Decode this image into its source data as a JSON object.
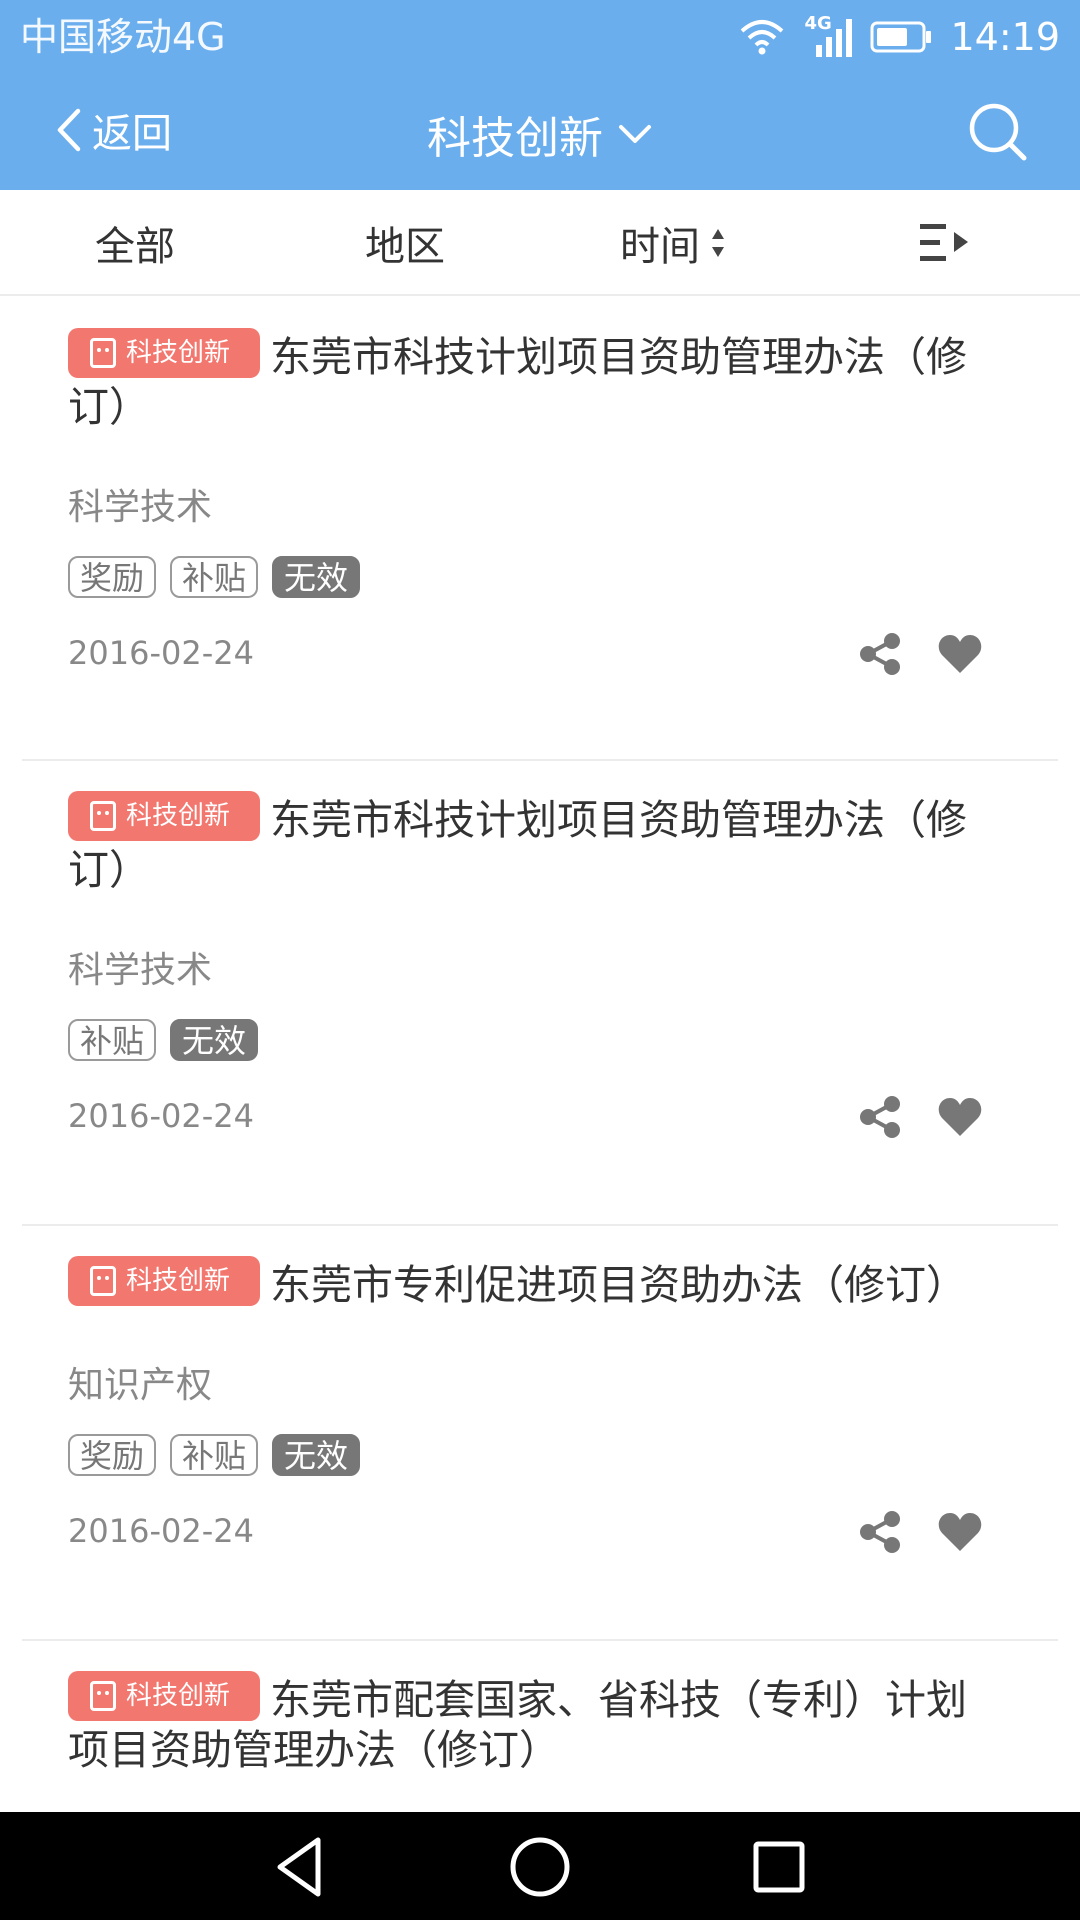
{
  "status_bar": {
    "carrier": "中国移动4G",
    "network": "4G",
    "time": "14:19"
  },
  "header": {
    "back_label": "返回",
    "title": "科技创新",
    "background_color": "#6aaeee"
  },
  "filters": [
    {
      "label": "全部"
    },
    {
      "label": "地区"
    },
    {
      "label": "时间"
    }
  ],
  "items": [
    {
      "badge": "科技创新",
      "title": "东莞市科技计划项目资助管理办法（修订）",
      "category": "科学技术",
      "tags": [
        "奖励",
        "补贴"
      ],
      "status": "无效",
      "date": "2016-02-24"
    },
    {
      "badge": "科技创新",
      "title": "东莞市科技计划项目资助管理办法（修订）",
      "category": "科学技术",
      "tags": [
        "补贴"
      ],
      "status": "无效",
      "date": "2016-02-24"
    },
    {
      "badge": "科技创新",
      "title": "东莞市专利促进项目资助办法（修订）",
      "category": "知识产权",
      "tags": [
        "奖励",
        "补贴"
      ],
      "status": "无效",
      "date": "2016-02-24"
    },
    {
      "badge": "科技创新",
      "title": "东莞市配套国家、省科技（专利）计划项目资助管理办法（修订）"
    }
  ],
  "colors": {
    "accent": "#6aaeee",
    "badge": "#f2776f",
    "status_tag": "#777777"
  }
}
